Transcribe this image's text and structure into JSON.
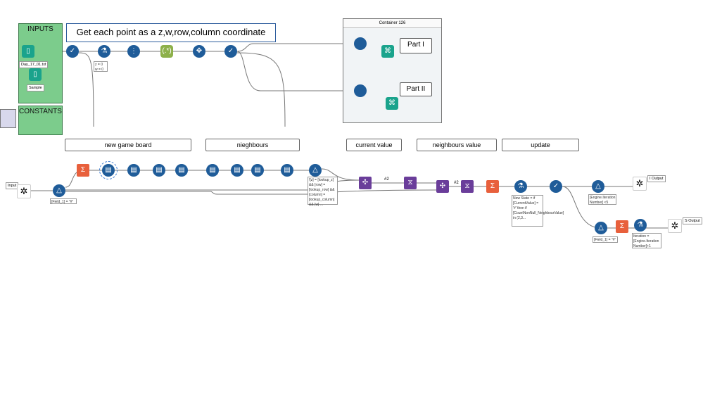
{
  "containers": {
    "inputs": "INPUTS",
    "constants": "CONSTANTS",
    "container126": "Container 126"
  },
  "title": "Get each point as a z,w,row,column coordinate",
  "inputs": {
    "file1": "Day_17_01.txt",
    "file2": "Sample"
  },
  "annotations": {
    "formula_init": "z = 0\nw = 0",
    "filter_input": "[Field_1] = \"#\"",
    "filter_join": "![z] = [lookup_z] && [row] = [lookup_row] && [column] = [lookup_column] && [w] ...",
    "formula_update": "New State = if [CurrentValue] = '#' then if [CountNonNull_NeighbourValue] in (2,3...",
    "filter_iter": "[Engine.Iteration Number] <5",
    "filter_field": "[Field_1] = \"#\"",
    "formula_iter": "Iteration = [Engine.Iteration Number]+1"
  },
  "parts": [
    "Part I",
    "Part II"
  ],
  "comments": [
    "new game board",
    "nieghbours",
    "current value",
    "neighbours value",
    "update"
  ],
  "macro": {
    "input": "Input",
    "i_output": "I Output",
    "s_output": "S Output"
  },
  "join_labels": [
    "#2",
    "#2"
  ],
  "icons": {
    "input": "book-icon",
    "select": "check-icon",
    "formula": "flask-icon",
    "recordid": "record-id-icon",
    "regex": "regex-icon",
    "crosstab": "crosstab-icon",
    "filter": "filter-icon",
    "summarize": "sigma-icon",
    "append": "append-icon",
    "join": "join-icon",
    "transpose": "dna-icon",
    "browse": "binoculars-icon",
    "macro": "gear-icon"
  },
  "colors": {
    "container": "#7ccc8c",
    "tool_blue": "#1f5c99",
    "join_purple": "#6a3d9a",
    "summarize_orange": "#e8603c",
    "browse_teal": "#1aa38c"
  }
}
